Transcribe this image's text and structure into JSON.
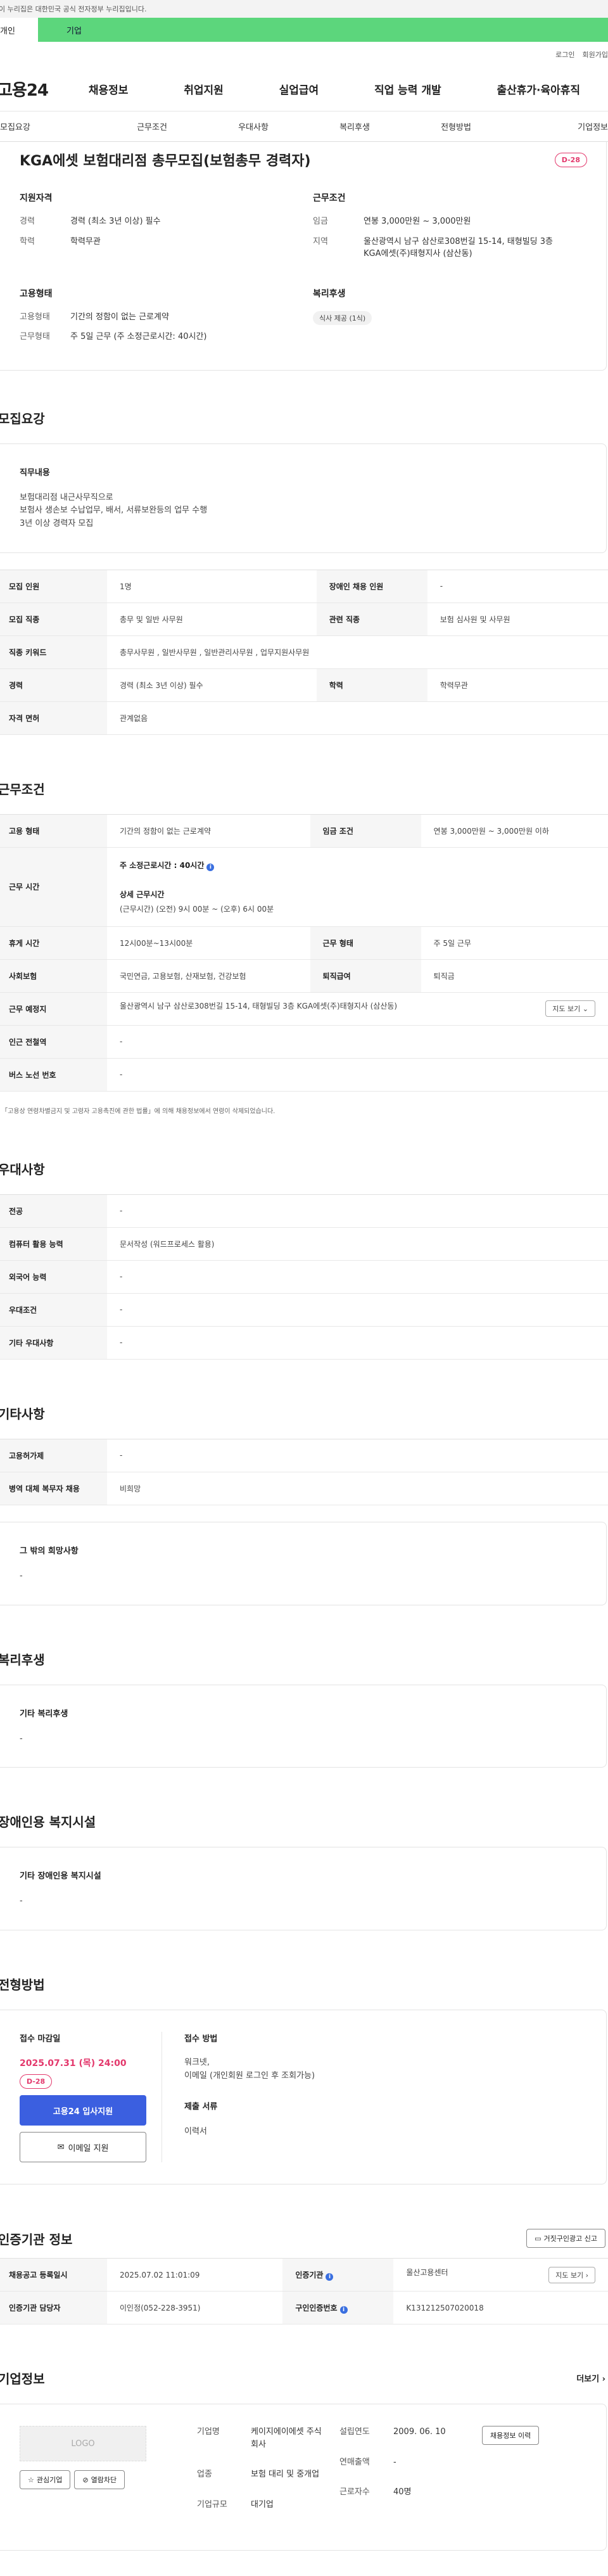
{
  "gov_notice": "이 누리집은 대한민국 공식 전자정부 누리집입니다.",
  "top_tabs": {
    "personal": "개인",
    "company": "기업"
  },
  "util_links": [
    "로그인",
    "회원가입"
  ],
  "logo": "고용24",
  "gnb": [
    "채용정보",
    "취업지원",
    "실업급여",
    "직업 능력 개발",
    "출산휴가·육아휴직"
  ],
  "anchor_nav": [
    "모집요강",
    "근무조건",
    "우대사항",
    "복리후생",
    "전형방법",
    "기업정보"
  ],
  "job": {
    "title": "KGA에셋 보험대리점 총무모집(보험총무 경력자)",
    "dday": "D-28"
  },
  "summary": {
    "qualification_title": "지원자격",
    "qualification": [
      {
        "k": "경력",
        "v": "경력 (최소 3년 이상) 필수"
      },
      {
        "k": "학력",
        "v": "학력무관"
      }
    ],
    "conditions_title": "근무조건",
    "conditions": [
      {
        "k": "임금",
        "v": "연봉 3,000만원 ~ 3,000만원"
      },
      {
        "k": "지역",
        "v": "울산광역시 남구 삼산로308번길 15-14, 태형빌딩 3층 KGA에셋(주)태형지사 (삼산동)"
      }
    ],
    "employment_title": "고용형태",
    "employment": [
      {
        "k": "고용형태",
        "v": "기간의 정함이 없는 근로계약"
      },
      {
        "k": "근무형태",
        "v": "주 5일 근무 (주 소정근로시간: 40시간)"
      }
    ],
    "welfare_title": "복리후생",
    "welfare_tag": "식사 제공 (1식)"
  },
  "recruit": {
    "section_title": "모집요강",
    "duty_title": "직무내용",
    "duty_lines": [
      "보험대리점 내근사무직으로",
      "보험사 생손보 수납업무, 배서, 서류보완등의 업무 수행",
      "3년 이상 경력자 모집"
    ],
    "rows": [
      {
        "k1": "모집 인원",
        "v1": "1명",
        "k2": "장애인 채용 인원",
        "v2": "-"
      },
      {
        "k1": "모집 직종",
        "v1": "총무 및 일반 사무원",
        "k2": "관련 직종",
        "v2": "보험 심사원 및 사무원"
      },
      {
        "k1": "직종 키워드",
        "v1": "총무사무원 , 일반사무원 , 일반관리사무원 , 업무지원사무원"
      },
      {
        "k1": "경력",
        "v1": "경력 (최소 3년 이상) 필수",
        "k2": "학력",
        "v2": "학력무관"
      },
      {
        "k1": "자격 면허",
        "v1": "관계없음"
      }
    ]
  },
  "work": {
    "section_title": "근무조건",
    "type_k": "고용 형태",
    "type_v": "기간의 정함이 없는 근로계약",
    "wage_k": "임금 조건",
    "wage_v": "연봉 3,000만원 ~ 3,000만원 이하",
    "hours_k": "근무 시간",
    "hours_main": "주 소정근로시간 : 40시간",
    "hours_detail_title": "상세 근무시간",
    "hours_detail": "(근무시간) (오전) 9시 00분 ~ (오후) 6시 00분",
    "break_k": "휴게 시간",
    "break_v": "12시00분~13시00분",
    "shape_k": "근무 형태",
    "shape_v": "주 5일 근무",
    "insurance_k": "사회보험",
    "insurance_v": "국민연금, 고용보험, 산재보험, 건강보험",
    "severance_k": "퇴직급여",
    "severance_v": "퇴직금",
    "place_k": "근무 예정지",
    "place_v": "울산광역시 남구 삼산로308번길 15-14, 태형빌딩 3층 KGA에셋(주)태형지사 (삼산동)",
    "map_btn": "지도 보기",
    "station_k": "인근 전철역",
    "station_v": "-",
    "bus_k": "버스 노선 번호",
    "bus_v": "-",
    "footnote": "* 「고용상 연령차별금지 및 고령자 고용촉진에 관한 법률」에 의해 채용정보에서 연령이 삭제되었습니다."
  },
  "prefer": {
    "section_title": "우대사항",
    "rows": [
      {
        "k": "전공",
        "v": "-"
      },
      {
        "k": "컴퓨터 활용 능력",
        "v": "문서작성 (워드프로세스 활용)"
      },
      {
        "k": "외국어 능력",
        "v": "-"
      },
      {
        "k": "우대조건",
        "v": "-"
      },
      {
        "k": "기타 우대사항",
        "v": "-"
      }
    ]
  },
  "etc": {
    "section_title": "기타사항",
    "rows": [
      {
        "k": "고용허가제",
        "v": "-"
      },
      {
        "k": "병역 대체 복무자 채용",
        "v": "비희망"
      }
    ],
    "other_title": "그 밖의 희망사항",
    "other_v": "-"
  },
  "benefit": {
    "section_title": "복리후생",
    "sub_title": "기타 복리후생",
    "v": "-"
  },
  "disability": {
    "section_title": "장애인용 복지시설",
    "sub_title": "기타 장애인용 복지시설",
    "v": "-"
  },
  "selection": {
    "section_title": "전형방법",
    "deadline_title": "접수 마감일",
    "deadline": "2025.07.31 (목) 24:00",
    "dday": "D-28",
    "apply_btn": "고용24 입사지원",
    "email_btn": "이메일 지원",
    "method_title": "접수 방법",
    "method_lines": [
      "워크넷,",
      "이메일 (개인회원 로그인 후 조회가능)"
    ],
    "docs_title": "제출 서류",
    "docs_v": "이력서"
  },
  "agency": {
    "section_title": "인증기관 정보",
    "report_btn": "거짓구인광고 신고",
    "reg_k": "채용공고 등록일시",
    "reg_v": "2025.07.02 11:01:09",
    "org_k": "인증기관",
    "org_v": "울산고용센터",
    "map_btn": "지도 보기",
    "manager_k": "인증기관 담당자",
    "manager_v": "이인정(052-228-3951)",
    "num_k": "구인인증번호",
    "num_v": "K131212507020018"
  },
  "company": {
    "section_title": "기업정보",
    "more": "더보기",
    "logo_ph": "LOGO",
    "fav_btn": "관심기업",
    "block_btn": "열람차단",
    "name_k": "기업명",
    "name_v": "케이지에이에셋 주식회사",
    "industry_k": "업종",
    "industry_v": "보험 대리 및 중개업",
    "size_k": "기업규모",
    "size_v": "대기업",
    "founded_k": "설립연도",
    "founded_v": "2009. 06. 10",
    "sales_k": "연매출액",
    "sales_v": "-",
    "staff_k": "근로자수",
    "staff_v": "40명",
    "history_btn": "채용정보 이력"
  }
}
